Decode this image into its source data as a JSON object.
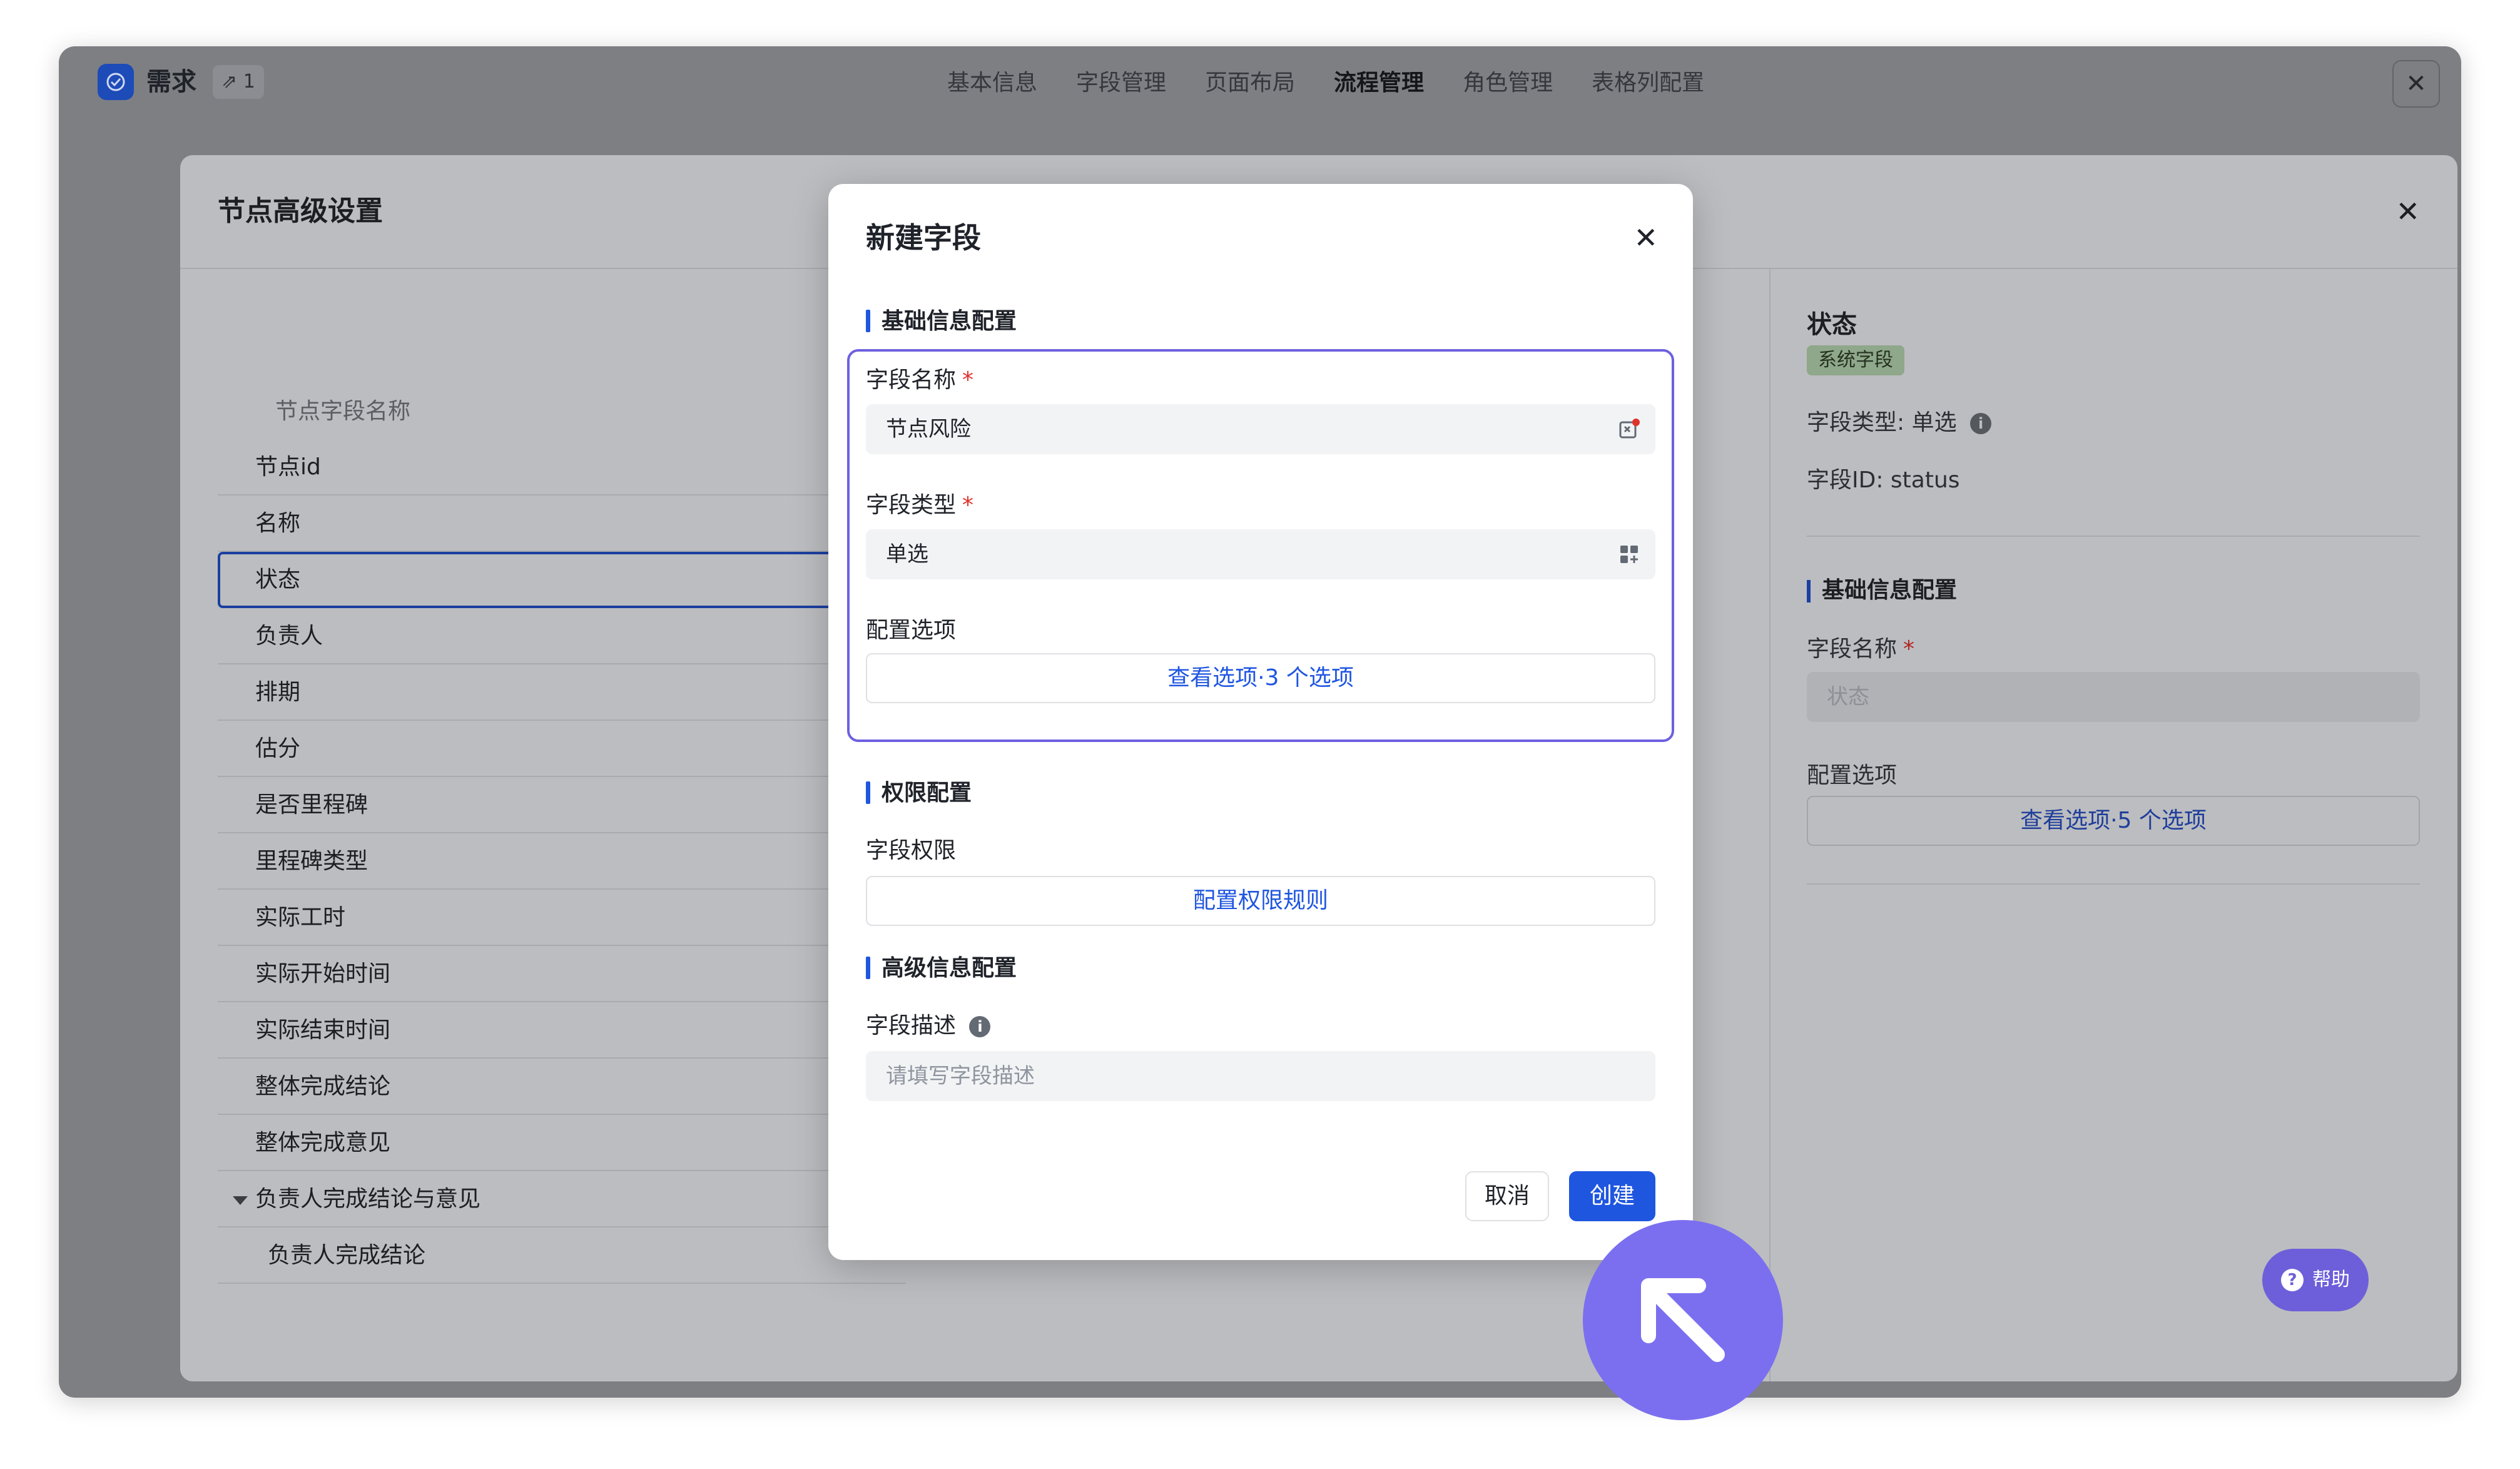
{
  "app": {
    "name": "需求",
    "count": "1"
  },
  "tabs": [
    {
      "label": "基本信息"
    },
    {
      "label": "字段管理"
    },
    {
      "label": "页面布局"
    },
    {
      "label": "流程管理",
      "active": true
    },
    {
      "label": "角色管理"
    },
    {
      "label": "表格列配置"
    }
  ],
  "panel": {
    "title": "节点高级设置",
    "column_header": "节点字段名称",
    "rows": [
      {
        "label": "节点id"
      },
      {
        "label": "名称"
      },
      {
        "label": "状态",
        "selected": true
      },
      {
        "label": "负责人"
      },
      {
        "label": "排期"
      },
      {
        "label": "估分"
      },
      {
        "label": "是否里程碑"
      },
      {
        "label": "里程碑类型"
      },
      {
        "label": "实际工时"
      },
      {
        "label": "实际开始时间"
      },
      {
        "label": "实际结束时间"
      },
      {
        "label": "整体完成结论"
      },
      {
        "label": "整体完成意见"
      },
      {
        "label": "负责人完成结论与意见",
        "expanded": true
      },
      {
        "label": "负责人完成结论",
        "child": true
      }
    ]
  },
  "sidebar": {
    "title": "状态",
    "tag": "系统字段",
    "field_type_label": "字段类型:",
    "field_type_value": "单选",
    "field_id_label": "字段ID:",
    "field_id_value": "status",
    "section_basic": "基础信息配置",
    "field_name_label": "字段名称",
    "field_name_value": "状态",
    "options_label": "配置选项",
    "options_button": "查看选项·5 个选项"
  },
  "modal": {
    "title": "新建字段",
    "section_basic": "基础信息配置",
    "field_name_label": "字段名称",
    "field_name_value": "节点风险",
    "field_type_label": "字段类型",
    "field_type_value": "单选",
    "options_label": "配置选项",
    "options_button": "查看选项·3 个选项",
    "section_permission": "权限配置",
    "permission_label": "字段权限",
    "permission_button": "配置权限规则",
    "section_advanced": "高级信息配置",
    "description_label": "字段描述",
    "description_placeholder": "请填写字段描述",
    "cancel_label": "取消",
    "create_label": "创建"
  },
  "help": {
    "label": "帮助"
  },
  "colors": {
    "accent": "#1f56e0",
    "highlight": "#6e60e0",
    "required": "#e0322c",
    "overlay": "#7e7f83"
  }
}
